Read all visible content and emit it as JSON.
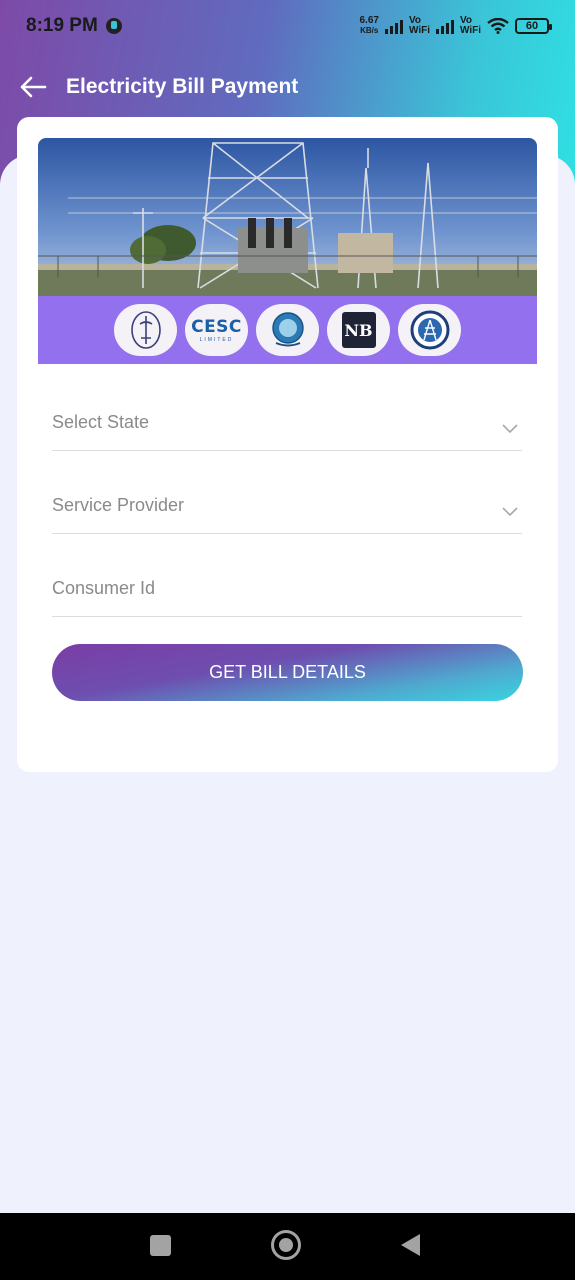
{
  "status_bar": {
    "time": "8:19 PM",
    "net_speed_value": "6.67",
    "net_speed_unit": "KB/s",
    "sim1_label_top": "Vo",
    "sim1_label_bottom": "WiFi",
    "sim2_label_top": "Vo",
    "sim2_label_bottom": "WiFi",
    "battery": "60"
  },
  "header": {
    "title": "Electricity Bill Payment"
  },
  "banner": {
    "logos": [
      "state-board-emblem",
      "CESC",
      "state-utility-emblem",
      "NB",
      "power-corporation-emblem"
    ],
    "cesc_logo_text": "CESC",
    "cesc_logo_subtext": "LIMITED",
    "nb_logo_text": "NB",
    "strip_color": "#9370ee"
  },
  "form": {
    "state_placeholder": "Select State",
    "provider_placeholder": "Service Provider",
    "consumer_placeholder": "Consumer Id",
    "submit_label": "GET BILL DETAILS"
  },
  "colors": {
    "gradient_start": "#7a3ea6",
    "gradient_end": "#38d5df",
    "page_bg": "#eff2fd"
  }
}
